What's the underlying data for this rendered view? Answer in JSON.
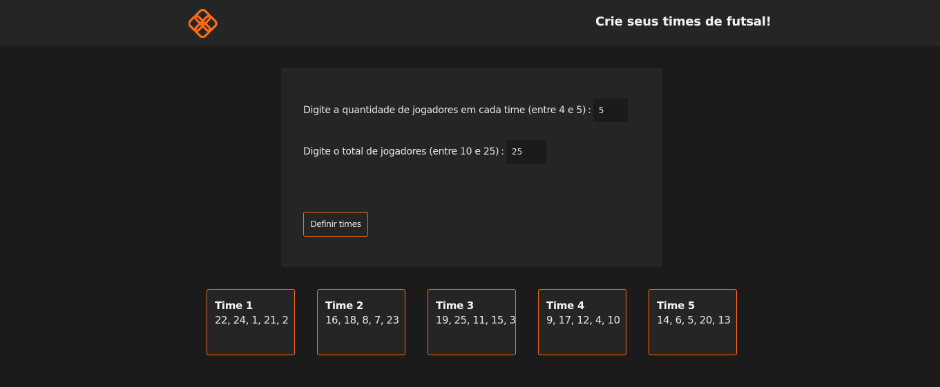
{
  "header": {
    "logo_icon": "orange-quatrefoil-logo-icon",
    "title": "Crie seus times de futsal!"
  },
  "form": {
    "players_per_team": {
      "label": "Digite a quantidade de jogadores em cada time (entre 4 e 5)",
      "colon": ":",
      "value": "5"
    },
    "total_players": {
      "label": "Digite o total de jogadores (entre 10 e 25)",
      "colon": ":",
      "value": "25"
    },
    "submit_label": "Definir times"
  },
  "teams": [
    {
      "name": "Time 1",
      "players": "22, 24, 1, 21, 2"
    },
    {
      "name": "Time 2",
      "players": "16, 18, 8, 7, 23"
    },
    {
      "name": "Time 3",
      "players": "19, 25, 11, 15, 3"
    },
    {
      "name": "Time 4",
      "players": "9, 17, 12, 4, 10"
    },
    {
      "name": "Time 5",
      "players": "14, 6, 5, 20, 13"
    }
  ],
  "colors": {
    "accent": "#ff6a14",
    "background": "#1b1b1b",
    "surface": "#252525",
    "text": "#e8e8e8"
  }
}
